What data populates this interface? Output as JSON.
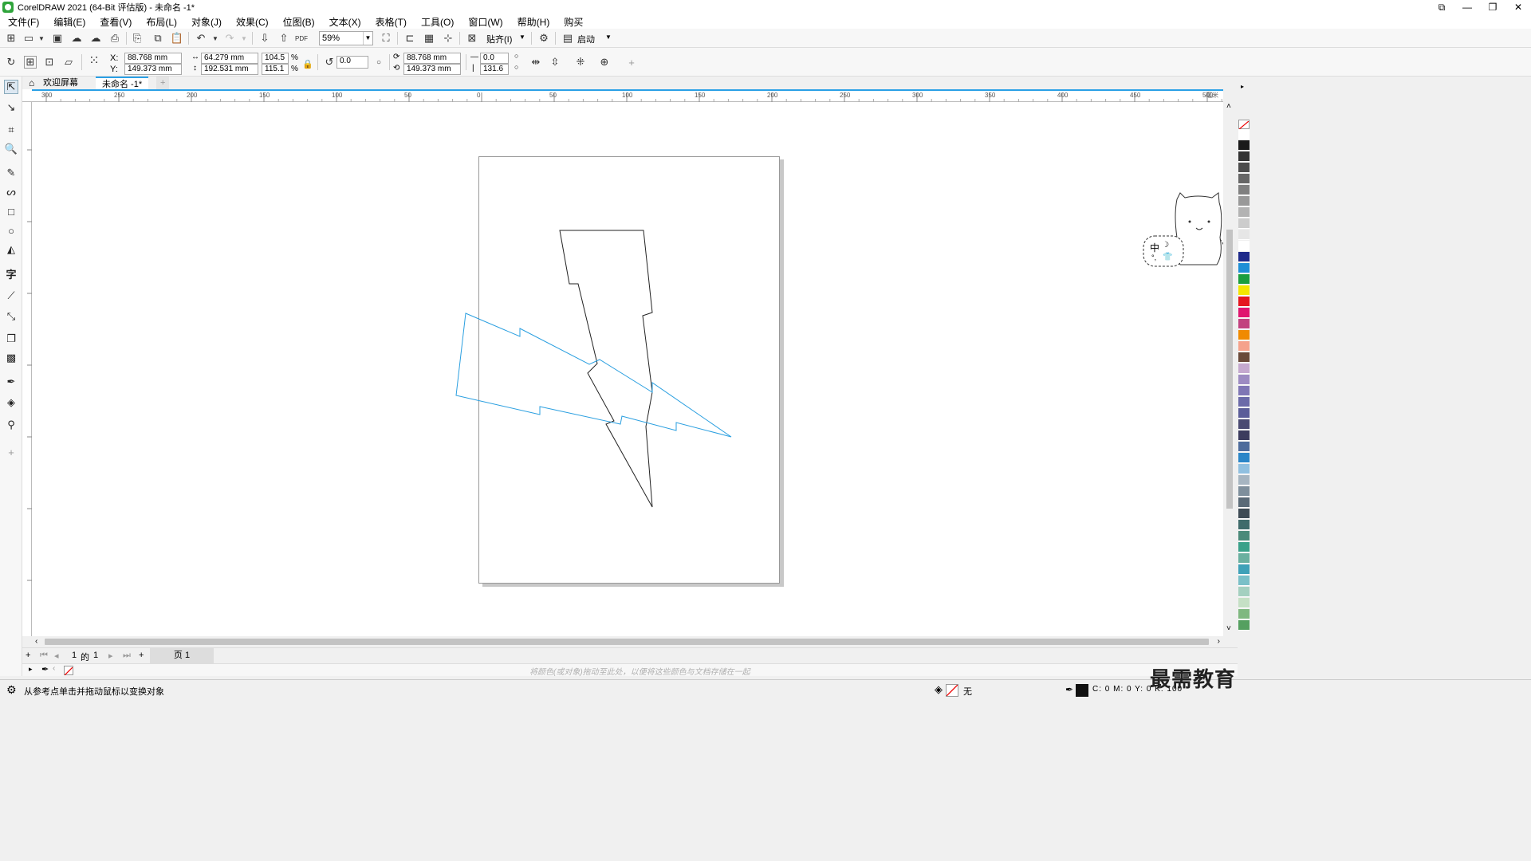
{
  "window": {
    "title": "CorelDRAW 2021 (64-Bit 评估版) - 未命名 -1*",
    "controls": [
      "⧉",
      "—",
      "❐",
      "✕"
    ]
  },
  "menu": [
    "文件(F)",
    "编辑(E)",
    "查看(V)",
    "布局(L)",
    "对象(J)",
    "效果(C)",
    "位图(B)",
    "文本(X)",
    "表格(T)",
    "工具(O)",
    "窗口(W)",
    "帮助(H)",
    "购买"
  ],
  "toolbar": {
    "zoom": "59%",
    "snap_label": "贴齐(I)",
    "launch_label": "启动",
    "pdf_label": "PDF"
  },
  "properties": {
    "x_label": "X:",
    "y_label": "Y:",
    "x": "88.768 mm",
    "y": "149.373 mm",
    "width": "64.279 mm",
    "height": "192.531 mm",
    "scale_x": "104.5",
    "scale_y": "115.1",
    "percent": "%",
    "rotation": "0.0",
    "center_x": "88.768 mm",
    "center_y": "149.373 mm",
    "skew_h": "0.0",
    "skew_v": "131.6"
  },
  "tabs": {
    "welcome": "欢迎屏幕",
    "document": "未命名 -1*"
  },
  "ruler": {
    "h_ticks": [
      "300",
      "250",
      "200",
      "150",
      "100",
      "50",
      "0",
      "50",
      "100",
      "150",
      "200",
      "250",
      "300",
      "350",
      "400",
      "450",
      "500"
    ],
    "unit": "毫米"
  },
  "pagenav": {
    "current": "1",
    "of": "的",
    "total": "1",
    "page_tab": "页 1"
  },
  "docpalette": {
    "hint": "将颜色(或对象)拖动至此处，以便将这些颜色与文档存储在一起"
  },
  "status": {
    "message": "从参考点单击并拖动鼠标以变换对象",
    "fill": "无",
    "color_readout": "C: 0 M: 0 Y: 0 K: 100"
  },
  "widget": {
    "label": "中"
  },
  "watermark": "最需教育",
  "colors": {
    "accent": "#2aa0e6",
    "selected_outline": "#2a9fe0",
    "outline": "#222222"
  },
  "palette": [
    "#ffffff",
    "#1a1a1a",
    "#333333",
    "#4d4d4d",
    "#666666",
    "#808080",
    "#999999",
    "#b3b3b3",
    "#cccccc",
    "#e6e6e6",
    "#ffffff",
    "#1e2a8a",
    "#1e8fd6",
    "#1a9e3e",
    "#f4e600",
    "#e5161f",
    "#e0156f",
    "#c2417f",
    "#f08a00",
    "#f5a28c",
    "#6a4a3a",
    "#c5a9cf",
    "#9d8bc2",
    "#7f76b5",
    "#6b6aa9",
    "#5b5d99",
    "#4a4a72",
    "#3b3b5e",
    "#4e6c9c",
    "#2b86c8",
    "#90c0e0",
    "#a6b5c1",
    "#7e8f9c",
    "#5a6a77",
    "#3e4b55",
    "#3f6b6b",
    "#4b8a7a",
    "#3aa18a",
    "#6ab0a0",
    "#3ea1b8",
    "#7ac0c8",
    "#a4d0c0",
    "#c5e0c5",
    "#7fb880",
    "#55a060"
  ]
}
